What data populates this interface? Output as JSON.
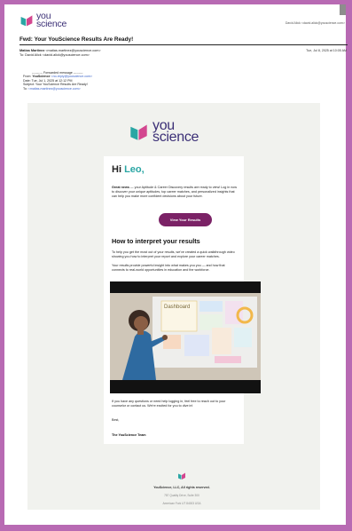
{
  "brand": {
    "name_line1": "you",
    "name_line2": "science",
    "colors": {
      "teal": "#2aa6a4",
      "purple": "#7b2266",
      "navy": "#3b2f76",
      "pink": "#d3468f"
    }
  },
  "top_sender": "David Alick <david.alick@youscience.com>",
  "subject": "Fwd: Your YouScience Results Are Ready!",
  "from_line": {
    "name": "Matias Martinez",
    "email": "<matias.martinez@youscience.com>"
  },
  "to_line": "To: David Alick <david.alick@youscience.com>",
  "datetime": "Tue, Jul 8, 2025 at 10:05 AM",
  "forwarded": {
    "separator": "---------- Forwarded message ---------",
    "from_label": "From: ",
    "from_name": "YouScience",
    "from_email": "<no-reply@youscience.com>",
    "date": "Date: Tue, Jul 1, 2025 at 12:12 PM",
    "subject": "Subject: Your YouScience Results Are Ready!",
    "to_label": "To: ",
    "to_email": "<matias.martinez@youscience.com>"
  },
  "email": {
    "greeting": "Hi ",
    "recipient_name": "Leo,",
    "intro_bold": "Great news",
    "intro_text": " — your Aptitude & Career Discovery results are ready to view! Log in now to discover your unique aptitudes, top career matches, and personalized insights that can help you make more confident decisions about your future.",
    "cta_label": "View Your Results",
    "section_title": "How to interpret your results",
    "para1": "To help you get the most out of your results, we've created a quick walkthrough video showing you how to interpret your report and explore your career matches.",
    "para2": "Your results provide powerful insight into what makes you you — and how that connects to real-world opportunities in education and the workforce.",
    "video_board_label": "Dashboard",
    "para3": "If you have any questions or need help logging in, feel free to reach out to your counselor or contact us. We're excited for you to dive in!",
    "signoff": "Best,",
    "team": "The YouScience Team"
  },
  "footer": {
    "company": "YouScience, LLC, All rights reserved.",
    "address1": "787 Quality Drive, Suite 300",
    "address2": "American Fork UT 84003 USA"
  }
}
